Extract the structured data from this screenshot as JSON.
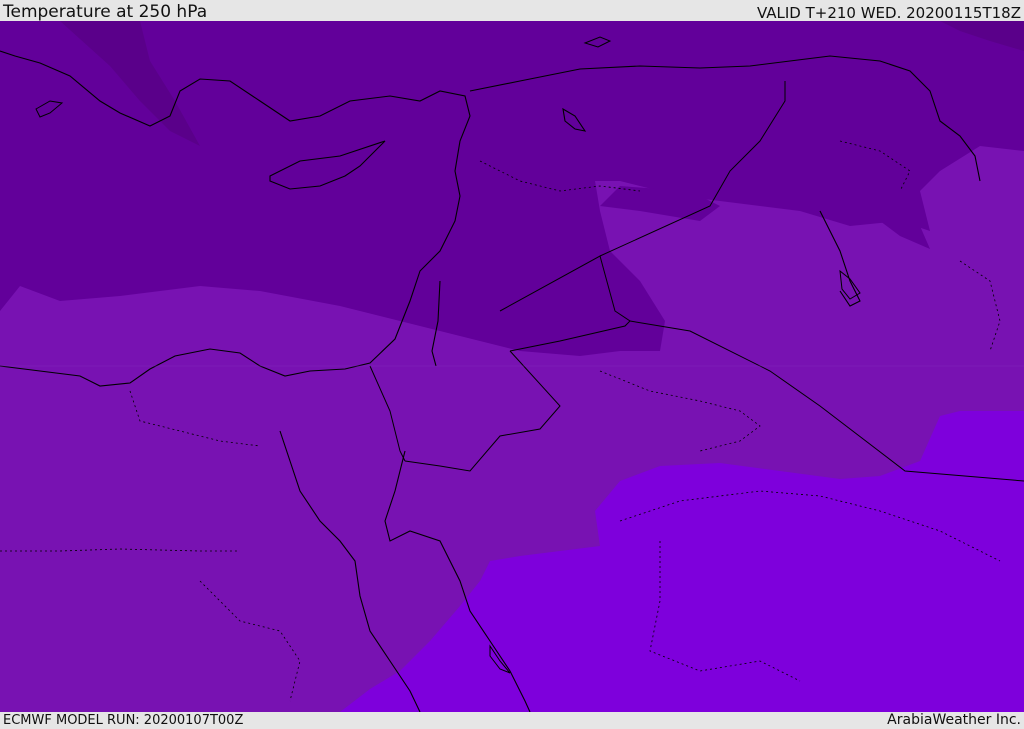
{
  "header": {
    "title": "Temperature at 250 hPa",
    "valid": "VALID T+210 WED. 20200115T18Z"
  },
  "footer": {
    "model_run": "ECMWF MODEL RUN: 20200107T00Z",
    "credit": "ArabiaWeather Inc."
  },
  "map": {
    "field": "temperature-250hPa",
    "colors": {
      "darkest": "#5a008a",
      "dark": "#62009a",
      "mid": "#7812b2",
      "light": "#7e00dc",
      "coast": "#000000",
      "border": "#000000"
    }
  }
}
